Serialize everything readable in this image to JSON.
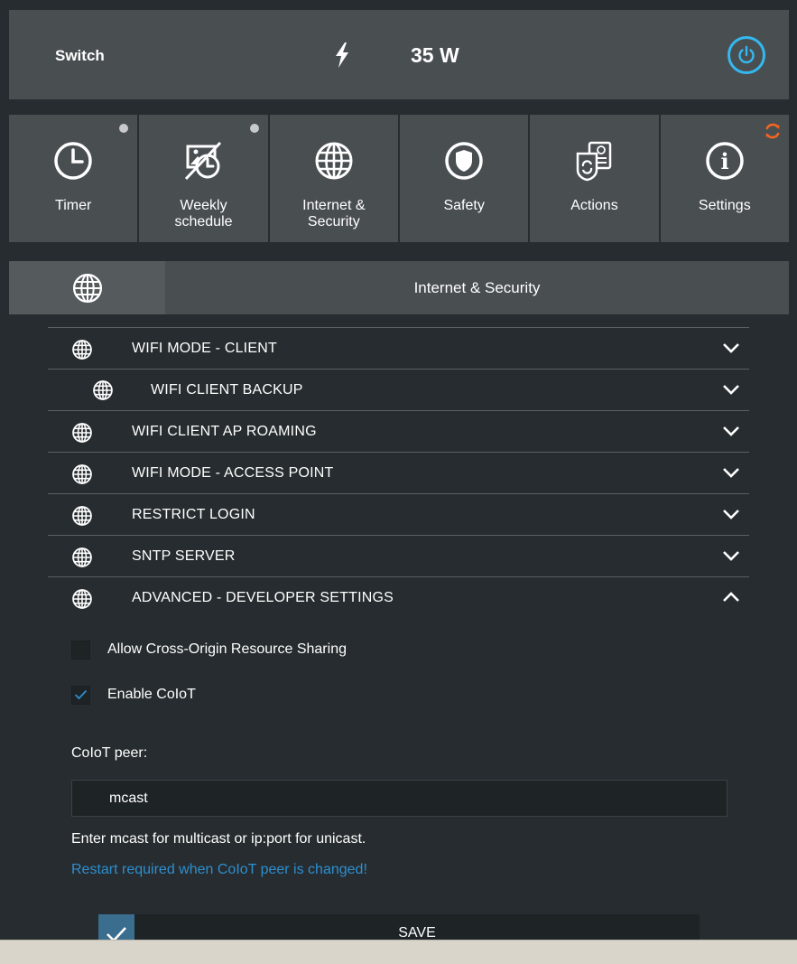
{
  "header": {
    "title": "Switch",
    "power_reading": "35 W"
  },
  "tiles": [
    {
      "label": "Timer",
      "icon": "clock-icon",
      "dot": true
    },
    {
      "label": "Weekly\nschedule",
      "icon": "calendar-image-icon",
      "dot": true
    },
    {
      "label": "Internet &\nSecurity",
      "icon": "globe-icon"
    },
    {
      "label": "Safety",
      "icon": "shield-icon"
    },
    {
      "label": "Actions",
      "icon": "actions-icon"
    },
    {
      "label": "Settings",
      "icon": "info-icon",
      "sync": true
    }
  ],
  "section": {
    "title": "Internet & Security"
  },
  "accordion": [
    {
      "label": "WIFI MODE - CLIENT",
      "expanded": false
    },
    {
      "label": "WIFI CLIENT BACKUP",
      "expanded": false,
      "sub": true
    },
    {
      "label": "WIFI CLIENT AP ROAMING",
      "expanded": false
    },
    {
      "label": "WIFI MODE - ACCESS POINT",
      "expanded": false
    },
    {
      "label": "RESTRICT LOGIN",
      "expanded": false
    },
    {
      "label": "SNTP SERVER",
      "expanded": false
    },
    {
      "label": "ADVANCED - DEVELOPER SETTINGS",
      "expanded": true
    }
  ],
  "advanced": {
    "cors_label": "Allow Cross-Origin Resource Sharing",
    "cors_checked": false,
    "coiot_label": "Enable CoIoT",
    "coiot_checked": true,
    "peer_label": "CoIoT peer:",
    "peer_value": "mcast",
    "help_text": "Enter mcast for multicast or ip:port for unicast.",
    "restart_note": "Restart required when CoIoT peer is changed!"
  },
  "save": {
    "label": "SAVE"
  },
  "colors": {
    "accent": "#35b8ef",
    "link": "#2e8fd0",
    "sync": "#f26522"
  }
}
